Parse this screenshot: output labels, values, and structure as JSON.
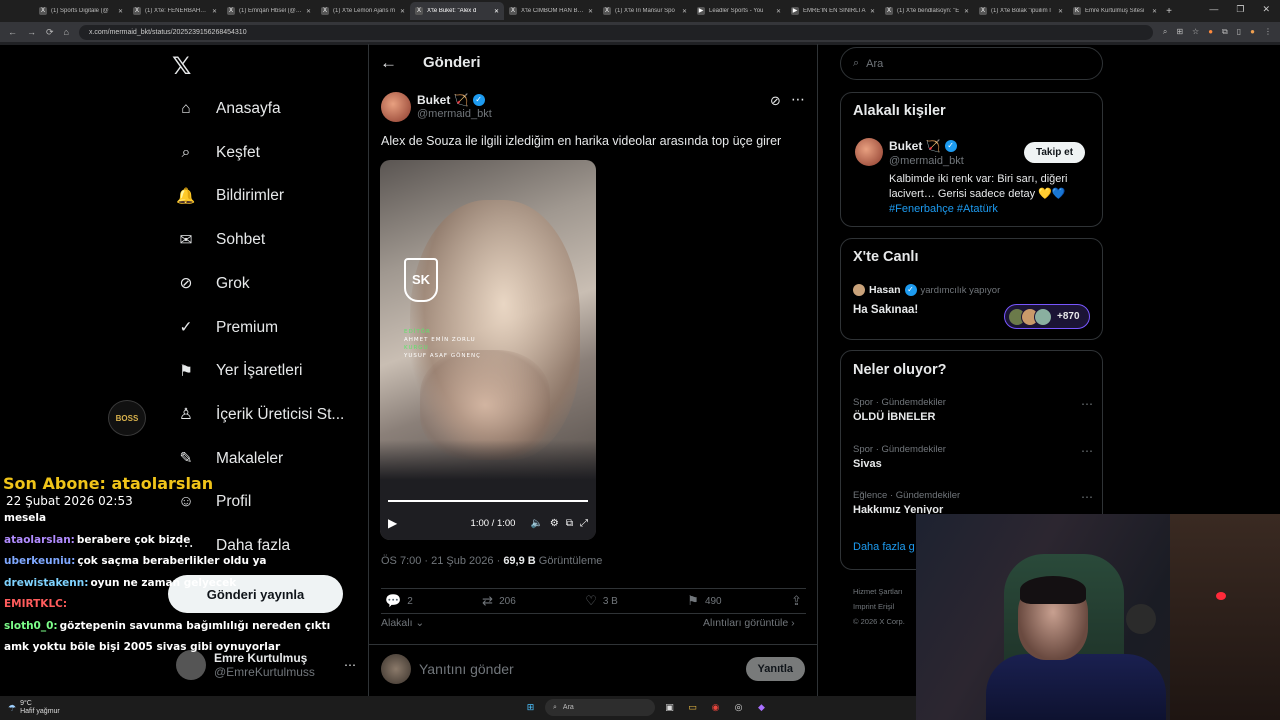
{
  "browser": {
    "tabs": [
      {
        "title": "(1) Sports Digitale (@",
        "fav": "X",
        "active": false
      },
      {
        "title": "(1) X'te: FENERBAHÇE",
        "fav": "X",
        "active": false
      },
      {
        "title": "(1) Emrqan Hbsel (@grg",
        "fav": "X",
        "active": false
      },
      {
        "title": "(1) X'te Lemon Ajans m",
        "fav": "X",
        "active": false
      },
      {
        "title": "X'te Buket: \"Alex d",
        "fav": "X",
        "active": true
      },
      {
        "title": "X'te CİMBOM HAN BEL",
        "fav": "X",
        "active": false
      },
      {
        "title": "(1) X'te İri Mansur Spo",
        "fav": "X",
        "active": false
      },
      {
        "title": "Leadler Sports - You ",
        "fav": "▶",
        "active": false
      },
      {
        "title": "EMRE'İN EN SİNİRLİ A",
        "fav": "▶",
        "active": false
      },
      {
        "title": "(1) X'te bendlalsoyn: \"E",
        "fav": "X",
        "active": false
      },
      {
        "title": "(1) X'te Bolak \"ipüilim İ",
        "fav": "X",
        "active": false
      },
      {
        "title": "Emre Kurtulmuş Sitesi",
        "fav": "K",
        "active": false
      }
    ],
    "url": "x.com/mermaid_bkt/status/2025239156268454310",
    "new_tab_label": "+",
    "window_controls": [
      "—",
      "❐",
      "✕"
    ]
  },
  "nav": {
    "items": [
      {
        "label": "Anasayfa",
        "icon": "home-icon",
        "glyph": "⌂"
      },
      {
        "label": "Keşfet",
        "icon": "search-icon",
        "glyph": "⌕"
      },
      {
        "label": "Bildirimler",
        "icon": "bell-icon",
        "glyph": "🔔"
      },
      {
        "label": "Sohbet",
        "icon": "envelope-icon",
        "glyph": "✉"
      },
      {
        "label": "Grok",
        "icon": "grok-icon",
        "glyph": "⊘"
      },
      {
        "label": "Premium",
        "icon": "premium-icon",
        "glyph": "✓"
      },
      {
        "label": "Yer İşaretleri",
        "icon": "bookmark-icon",
        "glyph": "⚑"
      },
      {
        "label": "İçerik Üreticisi St...",
        "icon": "creator-icon",
        "glyph": "♙"
      },
      {
        "label": "Makaleler",
        "icon": "article-icon",
        "glyph": "✎"
      },
      {
        "label": "Profil",
        "icon": "profile-icon",
        "glyph": "☺"
      },
      {
        "label": "Daha fazla",
        "icon": "more-circle-icon",
        "glyph": "⋯"
      }
    ],
    "post_button": "Gönderi yayınla",
    "account": {
      "name": "Emre Kurtulmuş",
      "handle": "@EmreKurtulmuss"
    }
  },
  "tweet": {
    "header_title": "Gönderi",
    "author_name": "Buket 🏹",
    "author_handle": "@mermaid_bkt",
    "text": "Alex de Souza ile ilgili izlediğim en harika videolar arasında top üçe girer",
    "video": {
      "logo_text": "SK",
      "credits": [
        {
          "text": "EDİTÖR",
          "color": "green"
        },
        {
          "text": "AHMET EMİN ZORLU",
          "color": "white"
        },
        {
          "text": "KURGU",
          "color": "green"
        },
        {
          "text": "YUSUF ASAF GÖNENÇ",
          "color": "white"
        }
      ],
      "time": "1:00 / 1:00",
      "progress": 1.0
    },
    "time_date": "ÖS 7:00 · 21 Şub 2026 ·",
    "views": "69,9 B",
    "views_label": "Görüntüleme",
    "actions": {
      "replies": "2",
      "retweets": "206",
      "likes": "3 B",
      "bookmarks": "490"
    },
    "relevant_label": "Alakalı ⌄",
    "quotes_label": "Alıntıları görüntüle ›",
    "reply_placeholder": "Yanıtını gönder",
    "reply_button": "Yanıtla"
  },
  "right": {
    "search_placeholder": "Ara",
    "related": {
      "title": "Alakalı kişiler",
      "name": "Buket 🏹",
      "handle": "@mermaid_bkt",
      "follow": "Takip et",
      "bio": "Kalbimde iki renk var: Biri sarı, diğeri lacivert… Gerisi sadece detay 💛💙",
      "tags": "#Fenerbahçe #Atatürk"
    },
    "live": {
      "title": "X'te Canlı",
      "host": "Hasan",
      "host_sub": "yardımcılık yapıyor",
      "space": "Ha Sakınaa!",
      "listeners": "+870"
    },
    "trends": {
      "title": "Neler oluyor?",
      "items": [
        {
          "category": "Spor · Gündemdekiler",
          "name": "ÖLDÜ İBNELER"
        },
        {
          "category": "Spor · Gündemdekiler",
          "name": "Sivas"
        },
        {
          "category": "Eğlence · Gündemdekiler",
          "name": "Hakkımız Yeniyor"
        }
      ],
      "show_more": "Daha fazla g"
    },
    "footer": [
      "Hizmet Şartları",
      "Imprint  Erişil",
      "© 2026 X Corp."
    ]
  },
  "overlay": {
    "sub_label": "Son Abone: ataolarslan",
    "sub_date": "22 Şubat 2026   02:53",
    "boss_badge": "BOSS",
    "chat": [
      {
        "user": "",
        "msg": "mesela",
        "color": "#ffffff"
      },
      {
        "user": "ataolarslan:",
        "msg": "berabere çok bizde",
        "color": "#b18cff"
      },
      {
        "user": "uberkeuniu:",
        "msg": "çok saçma beraberlikler oldu ya",
        "color": "#7fa8ff"
      },
      {
        "user": "drewistakenn:",
        "msg": "oyun ne zaman gelyecek",
        "color": "#7fd3ff"
      },
      {
        "user": "EMIRTKLC:",
        "msg": "",
        "color": "#ff5c5c"
      },
      {
        "user": "sloth0_0:",
        "msg": "göztepenin savunma bağımlılığı nereden çıktı",
        "color": "#7dff8a"
      },
      {
        "user": "",
        "msg": "amk yoktu böle bişi 2005 sivas gibi oynuyorlar",
        "color": "#ffffff"
      }
    ]
  },
  "taskbar": {
    "weather_temp": "9°C",
    "weather_desc": "Hafif yağmur",
    "search_label": "Ara"
  }
}
